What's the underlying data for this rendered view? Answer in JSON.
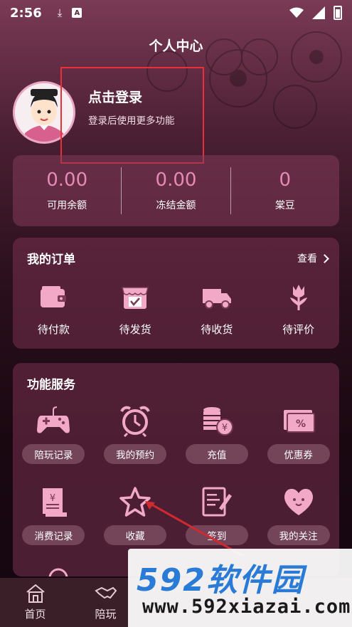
{
  "status_bar": {
    "time": "2:56"
  },
  "page_title": "个人中心",
  "login": {
    "title": "点击登录",
    "subtitle": "登录后使用更多功能"
  },
  "balances": [
    {
      "value": "0.00",
      "label": "可用余额"
    },
    {
      "value": "0.00",
      "label": "冻结金额"
    },
    {
      "value": "0",
      "label": "棠豆"
    }
  ],
  "orders": {
    "title": "我的订单",
    "more": "查看",
    "items": [
      {
        "label": "待付款",
        "icon": "wallet-icon"
      },
      {
        "label": "待发货",
        "icon": "shop-icon"
      },
      {
        "label": "待收货",
        "icon": "truck-icon"
      },
      {
        "label": "待评价",
        "icon": "flower-icon"
      }
    ]
  },
  "services": {
    "title": "功能服务",
    "items": [
      {
        "label": "陪玩记录",
        "icon": "gamepad-icon"
      },
      {
        "label": "我的预约",
        "icon": "alarm-clock-icon"
      },
      {
        "label": "充值",
        "icon": "coins-icon"
      },
      {
        "label": "优惠券",
        "icon": "coupon-icon"
      },
      {
        "label": "消费记录",
        "icon": "receipt-icon"
      },
      {
        "label": "收藏",
        "icon": "star-icon"
      },
      {
        "label": "签到",
        "icon": "sign-in-icon"
      },
      {
        "label": "我的关注",
        "icon": "heart-icon"
      }
    ]
  },
  "nav": [
    {
      "label": "首页",
      "icon": "home-icon"
    },
    {
      "label": "陪玩",
      "icon": "handshake-icon"
    },
    {
      "label": "",
      "icon": ""
    },
    {
      "label": "",
      "icon": ""
    },
    {
      "label": "",
      "icon": ""
    }
  ],
  "watermark": {
    "logo": "592软件园",
    "url": "www.592xiazai.com"
  },
  "colors": {
    "accent": "#e58ab4",
    "highlight_box": "#e8303a"
  }
}
